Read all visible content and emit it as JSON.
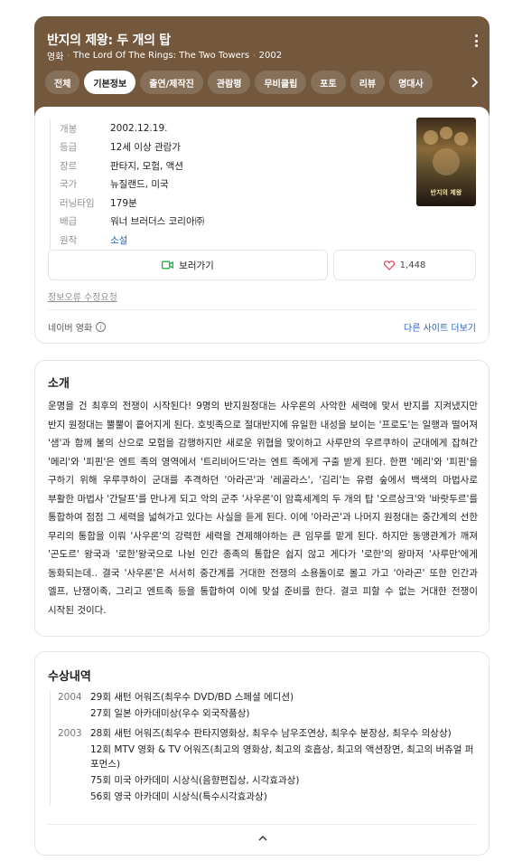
{
  "header": {
    "title": "반지의 제왕: 두 개의 탑",
    "category": "영화",
    "original_title": "The Lord Of The Rings: The Two Towers",
    "year": "2002",
    "tabs": [
      "전체",
      "기본정보",
      "출연/제작진",
      "관람평",
      "무비클립",
      "포토",
      "리뷰",
      "명대사"
    ],
    "active_tab": "기본정보"
  },
  "info": {
    "rows": [
      {
        "label": "개봉",
        "value": "2002.12.19."
      },
      {
        "label": "등급",
        "value": "12세 이상 관람가"
      },
      {
        "label": "장르",
        "value": "판타지, 모험, 액션"
      },
      {
        "label": "국가",
        "value": "뉴질랜드, 미국"
      },
      {
        "label": "러닝타임",
        "value": "179분"
      },
      {
        "label": "배급",
        "value": "워너 브러더스 코리아㈜"
      },
      {
        "label": "원작",
        "value": "소설"
      }
    ],
    "poster_text": "반지의 제왕",
    "watch_label": "보러가기",
    "like_count": "1,448",
    "report_label": "정보오류 수정요청",
    "source_label": "네이버 영화",
    "info_icon": "i",
    "more_sites_label": "다른 사이트 더보기",
    "colors": {
      "link": "#2a63c6",
      "header_bg": "#73583d",
      "like": "#e2424f",
      "watch": "#1fb141"
    }
  },
  "synopsis": {
    "title": "소개",
    "text": "운명을 건 최후의 전쟁이 시작된다! 9명의 반지원정대는 사우론의 사악한 세력에 맞서 반지를 지켜냈지만 반지 원정대는 뿔뿔이 흩어지게 된다. 호빗족으로 절대반지에 유일한 내성을 보이는 '프로도'는 일행과 떨어져 '샘'과 함께 불의 산으로 모험을 감행하지만 새로운 위협을 맞이하고 사루만의 우르쿠하이 군대에게 잡혀간 '메리'와 '피핀'은 엔트 족의 영역에서 '트리비어드'라는 엔트 족에게 구출 받게 된다. 한편 '메리'와 '피핀'을 구하기 위해 우루쿠하이 군대를 추격하던 '아라곤'과 '레골라스', '김리'는 유령 숲에서 백색의 마법사로 부활한 마법사 '간달프'를 만나게 되고 악의 군주 '사우론'이 암흑세계의 두 개의 탑 '오르상크'와 '바랏두르'를 통합하여 점점 그 세력을 넓혀가고 있다는 사실을 듣게 된다. 이에 '아라곤'과 나머지 원정대는 중간계의 선한 무리의 통합을 이뤄 '사우론'의 강력한 세력을 견제해야하는 큰 임무를 맡게 된다. 하지만 동맹관계가 깨져 '곤도르' 왕국과 '로한'왕국으로 나뉜 인간 종족의 통합은 쉽지 않고 게다가 '로한'의 왕마저 '사루만'에게 동화되는데.. 결국 '사우론'은 서서히 중간계를 거대한 전쟁의 소용돌이로 몰고 가고 '아라곤' 또한 인간과 엘프, 난쟁이족, 그리고 엔트족 등을 통합하여 이에 맞설 준비를 한다. 결코 피할 수 없는 거대한 전쟁이 시작된 것이다."
  },
  "awards": {
    "title": "수상내역",
    "groups": [
      {
        "year": "2004",
        "items": [
          "29회 새턴 어워즈(최우수 DVD/BD 스페셜 에디션)",
          "27회 일본 아카데미상(우수 외국작품상)"
        ]
      },
      {
        "year": "2003",
        "items": [
          "28회 새턴 어워즈(최우수 판타지영화상, 최우수 남우조연상, 최우수 분장상, 최우수 의상상)",
          "12회 MTV 영화 & TV 어워즈(최고의 영화상, 최고의 호흡상, 최고의 액션장면, 최고의 버츄얼 퍼포먼스)",
          "75회 미국 아카데미 시상식(음향편집상, 시각효과상)",
          "56회 영국 아카데미 시상식(특수시각효과상)"
        ]
      }
    ]
  }
}
